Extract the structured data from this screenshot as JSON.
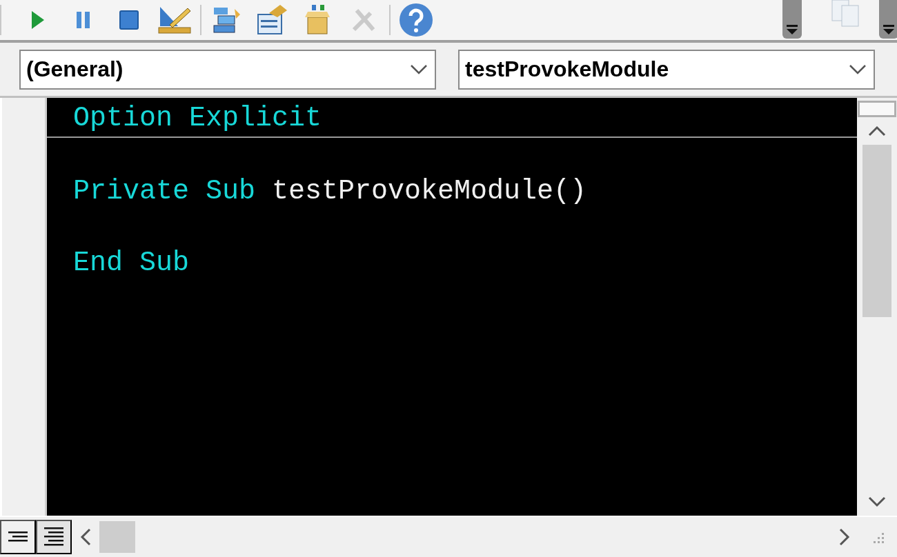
{
  "toolbar": [
    {
      "kind": "run",
      "disabled": false
    },
    {
      "kind": "pause",
      "disabled": false
    },
    {
      "kind": "stop",
      "disabled": false
    },
    {
      "kind": "design",
      "disabled": false
    },
    {
      "kind": "project",
      "disabled": false
    },
    {
      "kind": "properties",
      "disabled": false
    },
    {
      "kind": "browser",
      "disabled": false
    },
    {
      "kind": "toolbox",
      "disabled": true
    },
    {
      "kind": "help",
      "disabled": false
    }
  ],
  "object_dropdown": {
    "value": "(General)"
  },
  "procedure_dropdown": {
    "value": "testProvokeModule"
  },
  "code": {
    "lines": [
      {
        "separator": true,
        "tokens": [
          {
            "text": "Option Explicit",
            "kind": "keyword"
          }
        ]
      },
      {
        "separator": false
      },
      {
        "separator": false,
        "tokens": [
          {
            "text": "Private Sub ",
            "kind": "keyword"
          },
          {
            "text": "testProvokeModule()",
            "kind": "identifier"
          }
        ]
      },
      {
        "separator": false
      },
      {
        "separator": false,
        "tokens": [
          {
            "text": "End Sub",
            "kind": "keyword"
          }
        ]
      }
    ]
  },
  "view_buttons": [
    {
      "kind": "procedure",
      "selected": false
    },
    {
      "kind": "module",
      "selected": true
    }
  ]
}
